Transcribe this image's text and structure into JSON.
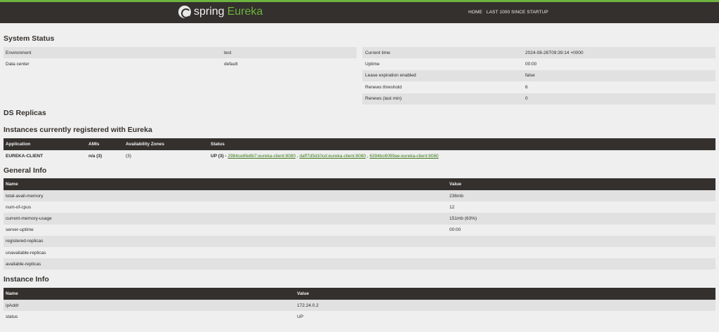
{
  "nav": {
    "brand_spring": "spring",
    "brand_eureka": "Eureka",
    "links": [
      "HOME",
      "LAST 1000 SINCE STARTUP"
    ]
  },
  "system_status": {
    "title": "System Status",
    "left": [
      {
        "key": "Environment",
        "value": "test"
      },
      {
        "key": "Data center",
        "value": "default"
      }
    ],
    "right": [
      {
        "key": "Current time",
        "value": "2024-08-26T09:39:14 +0000"
      },
      {
        "key": "Uptime",
        "value": "00:00"
      },
      {
        "key": "Lease expiration enabled",
        "value": "false"
      },
      {
        "key": "Renews threshold",
        "value": "6"
      },
      {
        "key": "Renews (last min)",
        "value": "0"
      }
    ]
  },
  "ds_replicas": {
    "title": "DS Replicas"
  },
  "instances": {
    "title": "Instances currently registered with Eureka",
    "headers": [
      "Application",
      "AMIs",
      "Availability Zones",
      "Status"
    ],
    "rows": [
      {
        "application": "EUREKA-CLIENT",
        "amis": "n/a (3)",
        "zones": "(3)",
        "status_prefix": "UP (3) - ",
        "instance_links": [
          "2984ce6fe8b7:eureka-client:8080",
          "daff7d5d10cd:eureka-client:8080",
          "6394bc6099ae:eureka-client:8080"
        ],
        "separator": " , "
      }
    ]
  },
  "general_info": {
    "title": "General Info",
    "headers": [
      "Name",
      "Value"
    ],
    "rows": [
      {
        "name": "total-avail-memory",
        "value": "236mb"
      },
      {
        "name": "num-of-cpus",
        "value": "12"
      },
      {
        "name": "current-memory-usage",
        "value": "151mb (63%)"
      },
      {
        "name": "server-uptime",
        "value": "00:00"
      },
      {
        "name": "registered-replicas",
        "value": ""
      },
      {
        "name": "unavailable-replicas",
        "value": ""
      },
      {
        "name": "available-replicas",
        "value": ""
      }
    ]
  },
  "instance_info": {
    "title": "Instance Info",
    "headers": [
      "Name",
      "Value"
    ],
    "rows": [
      {
        "name": "ipAddr",
        "value": "172.24.0.2"
      },
      {
        "name": "status",
        "value": "UP"
      }
    ]
  }
}
